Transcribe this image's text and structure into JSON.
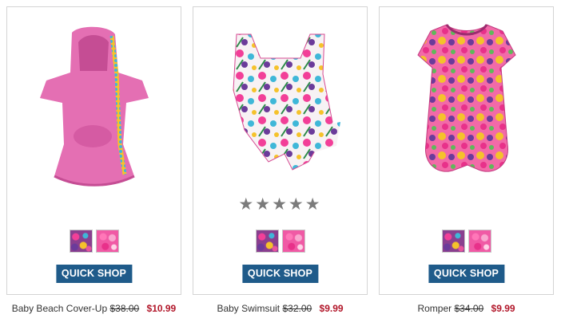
{
  "products": [
    {
      "name": "Baby Beach Cover-Up",
      "original_price": "$38.00",
      "sale_price": "$10.99",
      "image_icon": "pink-hooded-cover-up-image",
      "rating": null,
      "swatches": [
        "floral-multicolor-swatch",
        "pink-floral-swatch"
      ],
      "button_label": "QUICK SHOP"
    },
    {
      "name": "Baby Swimsuit",
      "original_price": "$32.00",
      "sale_price": "$9.99",
      "image_icon": "floral-swimsuit-image",
      "rating_stars": "★★★★★",
      "swatches": [
        "floral-multicolor-swatch",
        "pink-floral-swatch"
      ],
      "button_label": "QUICK SHOP"
    },
    {
      "name": "Romper",
      "original_price": "$34.00",
      "sale_price": "$9.99",
      "image_icon": "floral-romper-image",
      "rating": null,
      "swatches": [
        "floral-multicolor-swatch",
        "pink-floral-swatch"
      ],
      "button_label": "QUICK SHOP"
    }
  ],
  "colors": {
    "button": "#1f5b8a",
    "sale_price": "#b2182b",
    "star": "#7b7b7b"
  }
}
